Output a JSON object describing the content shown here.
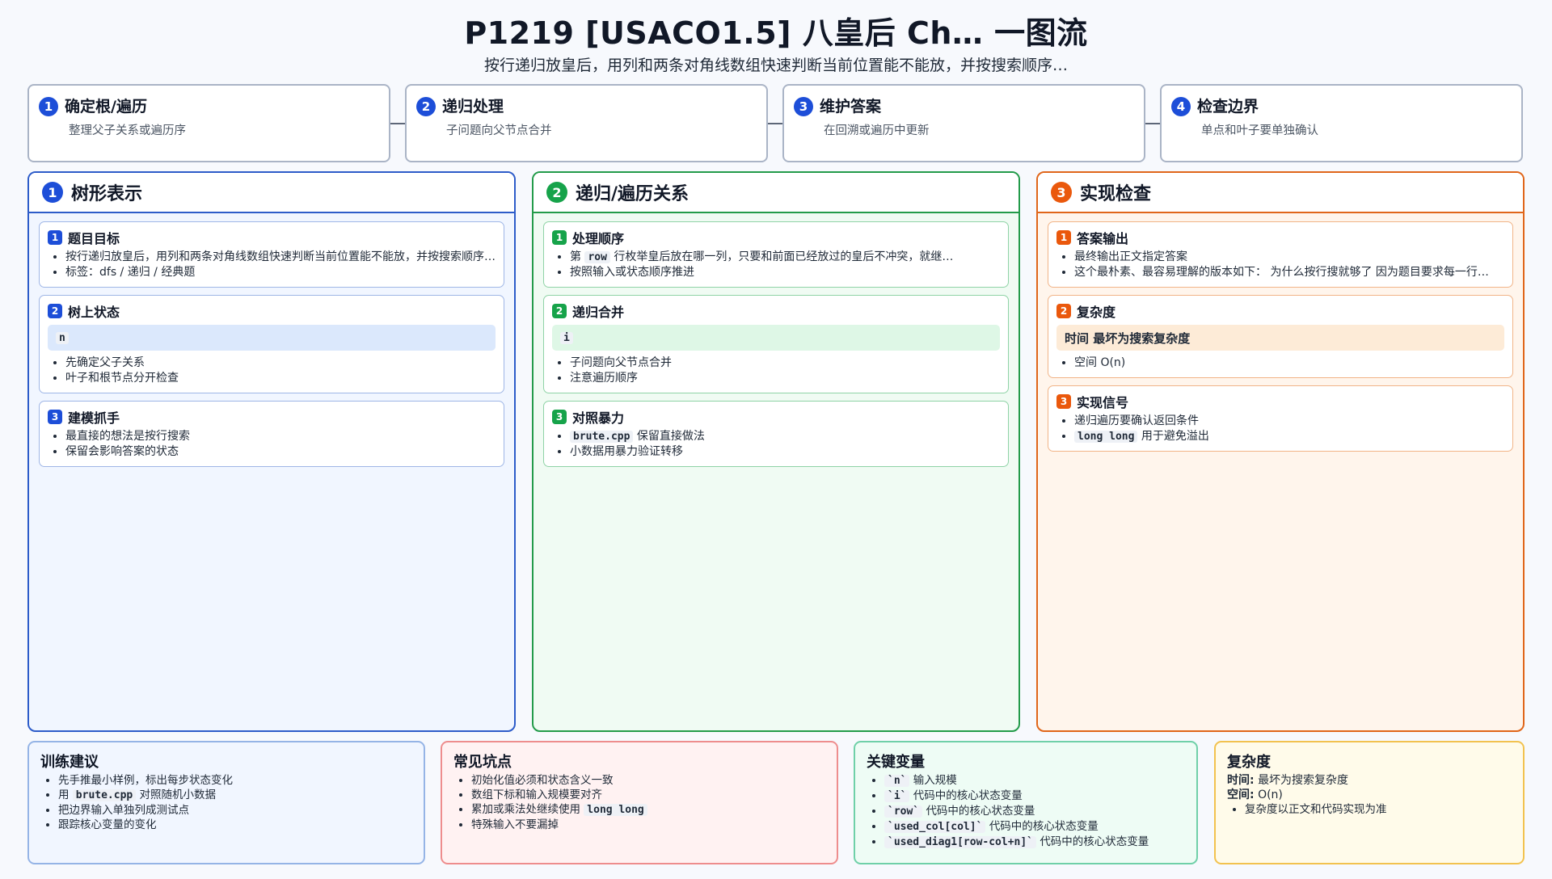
{
  "header": {
    "title": "P1219 [USACO1.5] 八皇后 Ch… 一图流",
    "subtitle": "按行递归放皇后，用列和两条对角线数组快速判断当前位置能不能放，并按搜索顺序…"
  },
  "steps": [
    {
      "num": "1",
      "title": "确定根/遍历",
      "desc": "整理父子关系或遍历序"
    },
    {
      "num": "2",
      "title": "递归处理",
      "desc": "子问题向父节点合并"
    },
    {
      "num": "3",
      "title": "维护答案",
      "desc": "在回溯或遍历中更新"
    },
    {
      "num": "4",
      "title": "检查边界",
      "desc": "单点和叶子要单独确认"
    }
  ],
  "columns": {
    "col1": {
      "num": "1",
      "title": "树形表示",
      "cards": {
        "c1": {
          "num": "1",
          "title": "题目目标",
          "items": [
            "按行递归放皇后，用列和两条对角线数组快速判断当前位置能不能放，并按搜索顺序…",
            "标签：dfs / 递归 / 经典题"
          ]
        },
        "c2": {
          "num": "2",
          "title": "树上状态",
          "band": "n",
          "items": [
            "先确定父子关系",
            "叶子和根节点分开检查"
          ]
        },
        "c3": {
          "num": "3",
          "title": "建模抓手",
          "items": [
            "最直接的想法是按行搜索",
            "保留会影响答案的状态"
          ]
        }
      }
    },
    "col2": {
      "num": "2",
      "title": "递归/遍历关系",
      "cards": {
        "c1": {
          "num": "1",
          "title": "处理顺序",
          "item1_pre": "第",
          "item1_code": "row",
          "item1_post": "行枚举皇后放在哪一列，只要和前面已经放过的皇后不冲突，就继…",
          "item2": "按照输入或状态顺序推进"
        },
        "c2": {
          "num": "2",
          "title": "递归合并",
          "band": "i",
          "items": [
            "子问题向父节点合并",
            "注意遍历顺序"
          ]
        },
        "c3": {
          "num": "3",
          "title": "对照暴力",
          "item1_code": "brute.cpp",
          "item1_post": "保留直接做法",
          "item2": "小数据用暴力验证转移"
        }
      }
    },
    "col3": {
      "num": "3",
      "title": "实现检查",
      "cards": {
        "c1": {
          "num": "1",
          "title": "答案输出",
          "items": [
            "最终输出正文指定答案",
            "这个最朴素、最容易理解的版本如下： 为什么按行搜就够了 因为题目要求每一行…"
          ]
        },
        "c2": {
          "num": "2",
          "title": "复杂度",
          "band": "时间 最坏为搜索复杂度",
          "items": [
            "空间 O(n)"
          ]
        },
        "c3": {
          "num": "3",
          "title": "实现信号",
          "item1": "递归遍历要确认返回条件",
          "item2_code": "long long",
          "item2_post": "用于避免溢出"
        }
      }
    }
  },
  "bottom": {
    "training": {
      "title": "训练建议",
      "item1": "先手推最小样例，标出每步状态变化",
      "item2_pre": "用",
      "item2_code": "brute.cpp",
      "item2_post": "对照随机小数据",
      "item3": "把边界输入单独列成测试点",
      "item4": "跟踪核心变量的变化"
    },
    "pitfalls": {
      "title": "常见坑点",
      "item1": "初始化值必须和状态含义一致",
      "item2": "数组下标和输入规模要对齐",
      "item3_pre": "累加或乘法处继续使用",
      "item3_code": "long long",
      "item4": "特殊输入不要漏掉"
    },
    "variables": {
      "title": "关键变量",
      "items": [
        {
          "code": "`n`",
          "desc": "输入规模"
        },
        {
          "code": "`i`",
          "desc": "代码中的核心状态变量"
        },
        {
          "code": "`row`",
          "desc": "代码中的核心状态变量"
        },
        {
          "code": "`used_col[col]`",
          "desc": "代码中的核心状态变量"
        },
        {
          "code": "`used_diag1[row-col+n]`",
          "desc": "代码中的核心状态变量"
        }
      ]
    },
    "complexity": {
      "title": "复杂度",
      "time_label": "时间:",
      "time_value": "最坏为搜索复杂度",
      "space_label": "空间:",
      "space_value": "O(n)",
      "note": "复杂度以正文和代码实现为准"
    }
  },
  "colors": {
    "blue": "#1d4ed8",
    "green": "#16a34a",
    "orange": "#ea580c"
  }
}
